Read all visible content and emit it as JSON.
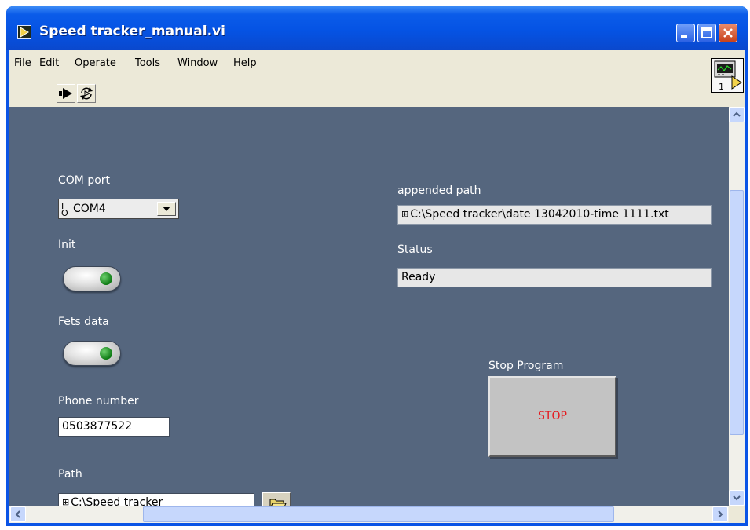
{
  "window": {
    "title": "Speed tracker_manual.vi"
  },
  "menu": {
    "items": [
      "File",
      "Edit",
      "Operate",
      "Tools",
      "Window",
      "Help"
    ]
  },
  "toolbar": {
    "run_icon": "run-arrow-icon",
    "run_continuously_icon": "run-continuously-icon",
    "vi_icon_number": "1"
  },
  "panel": {
    "com_port": {
      "label": "COM port",
      "prefix": "I/O",
      "value": "COM4"
    },
    "init": {
      "label": "Init"
    },
    "fets_data": {
      "label": "Fets data"
    },
    "phone_number": {
      "label": "Phone number",
      "value": "0503877522"
    },
    "path": {
      "label": "Path",
      "value": "C:\\Speed tracker"
    },
    "appended_path": {
      "label": "appended path",
      "value": "C:\\Speed tracker\\date 13042010-time 1111.txt"
    },
    "status": {
      "label": "Status",
      "value": "Ready"
    },
    "stop": {
      "label": "Stop Program",
      "button_text": "STOP"
    }
  },
  "colors": {
    "panel_background": "#55667e",
    "stop_text": "#e6161b",
    "titlebar_blue": "#0553e4"
  }
}
